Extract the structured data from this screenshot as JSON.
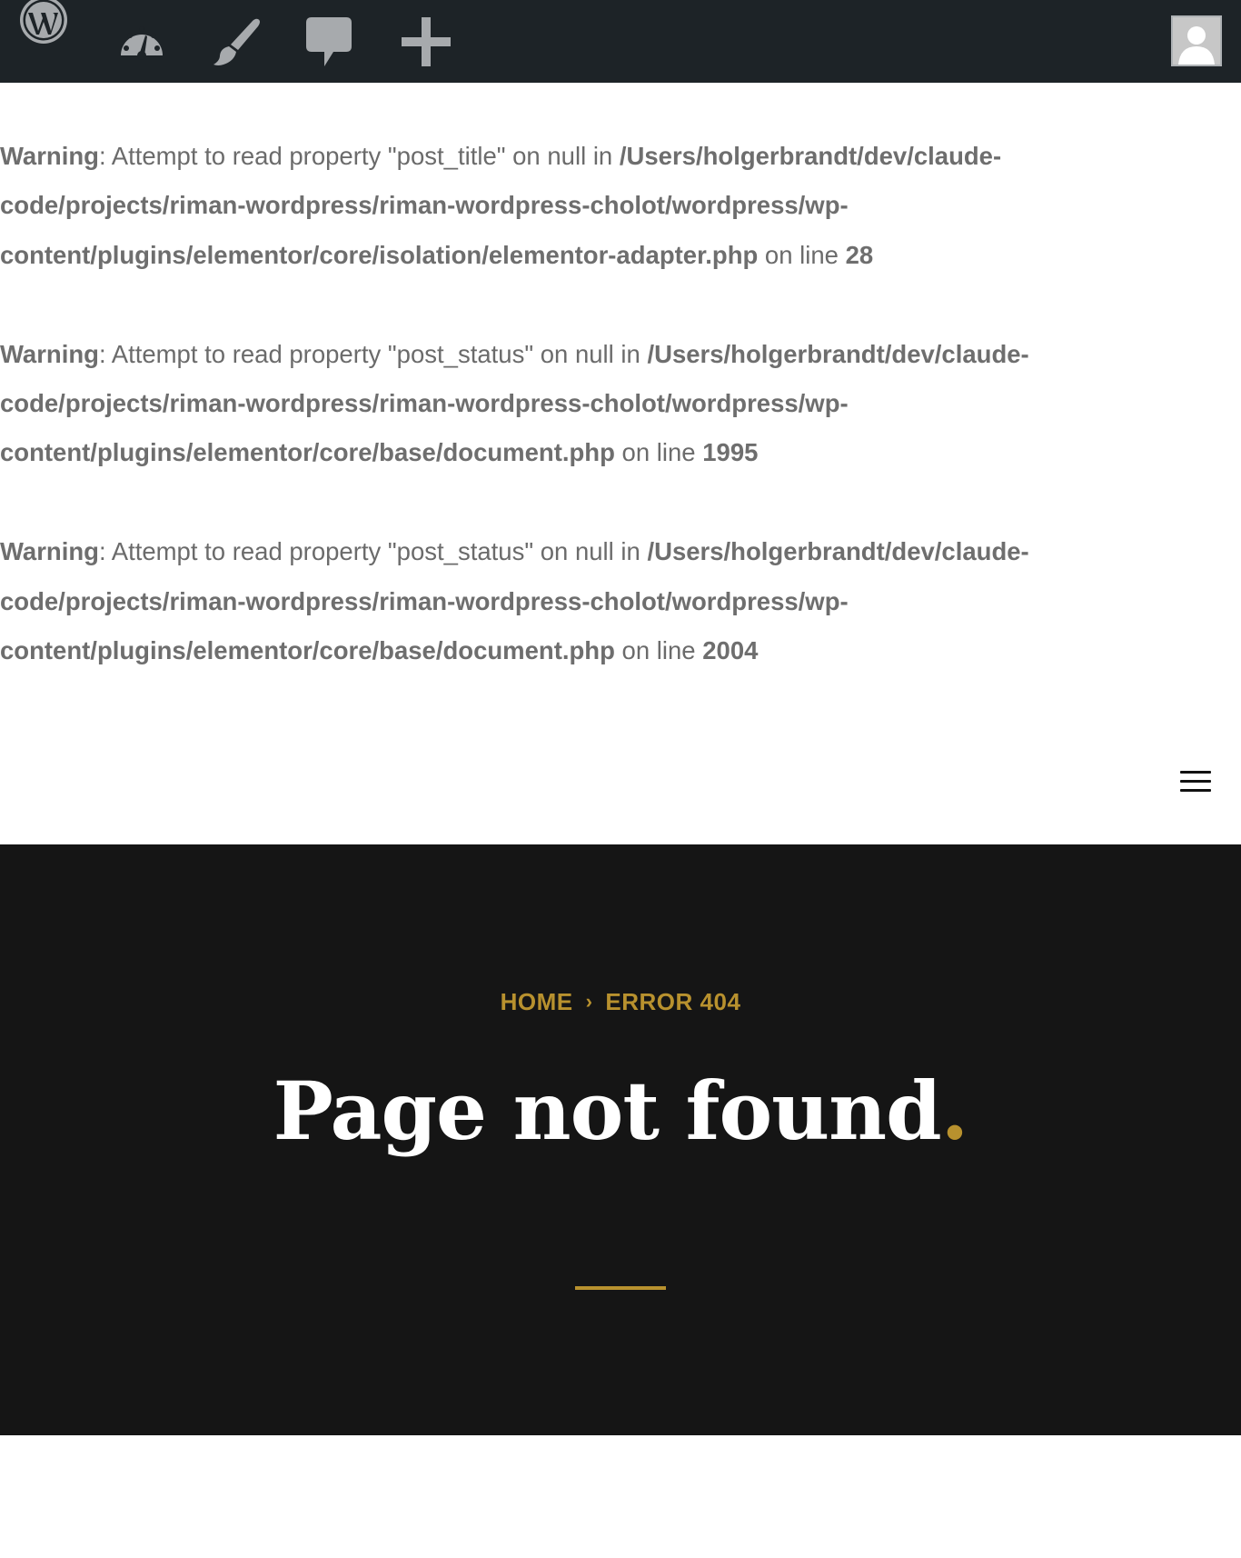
{
  "admin_bar": {
    "icons": [
      "wordpress-logo-icon",
      "dashboard-icon",
      "customize-brush-icon",
      "comments-icon",
      "new-content-icon"
    ],
    "avatar": "user-avatar"
  },
  "warnings": [
    {
      "label": "Warning",
      "message": ": Attempt to read property \"post_title\" on null in ",
      "path": "/Users/holgerbrandt/dev/claude-code/projects/riman-wordpress/riman-wordpress-cholot/wordpress/wp-content/plugins/elementor/core/isolation/elementor-adapter.php",
      "on_line": " on line ",
      "line": "28"
    },
    {
      "label": "Warning",
      "message": ": Attempt to read property \"post_status\" on null in ",
      "path": "/Users/holgerbrandt/dev/claude-code/projects/riman-wordpress/riman-wordpress-cholot/wordpress/wp-content/plugins/elementor/core/base/document.php",
      "on_line": " on line ",
      "line": "1995"
    },
    {
      "label": "Warning",
      "message": ": Attempt to read property \"post_status\" on null in ",
      "path": "/Users/holgerbrandt/dev/claude-code/projects/riman-wordpress/riman-wordpress-cholot/wordpress/wp-content/plugins/elementor/core/base/document.php",
      "on_line": " on line ",
      "line": "2004"
    }
  ],
  "hero": {
    "breadcrumb": {
      "home": "HOME",
      "separator": "›",
      "current": "ERROR 404"
    },
    "title": "Page not found",
    "title_dot": ".",
    "accent_color": "#b8912e",
    "background_color": "#151515"
  },
  "colors": {
    "admin_bar_bg": "#1d2327",
    "admin_icon": "#a7aaad",
    "warning_text": "#6b6b6b"
  }
}
